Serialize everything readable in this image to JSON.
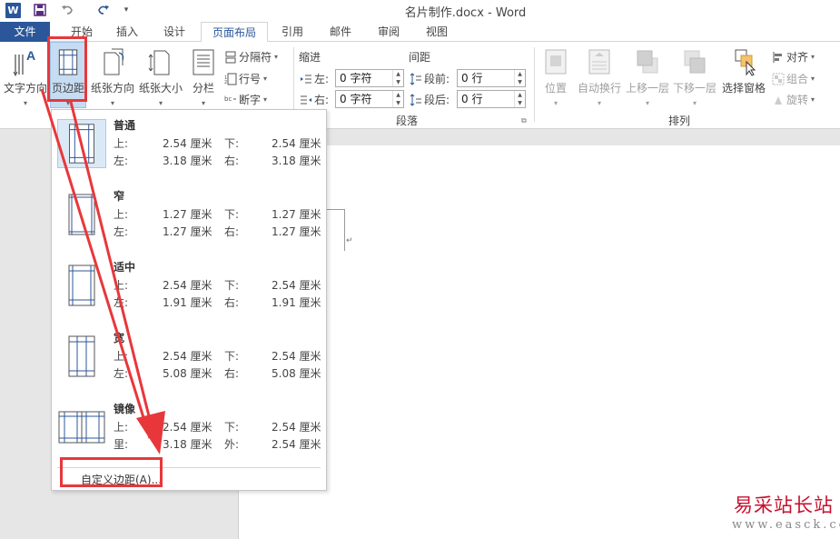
{
  "window": {
    "title": "名片制作.docx - Word"
  },
  "tabs": [
    "文件",
    "开始",
    "插入",
    "设计",
    "页面布局",
    "引用",
    "邮件",
    "审阅",
    "视图"
  ],
  "ribbon": {
    "page_setup": {
      "text_direction": "文字方向",
      "margins": "页边距",
      "orientation": "纸张方向",
      "size": "纸张大小",
      "columns": "分栏",
      "breaks": "分隔符",
      "line_numbers": "行号",
      "hyphenation": "断字"
    },
    "paragraph": {
      "indent_label": "缩进",
      "spacing_label": "间距",
      "left_label": "左:",
      "right_label": "右:",
      "before_label": "段前:",
      "after_label": "段后:",
      "left_value": "0 字符",
      "right_value": "0 字符",
      "before_value": "0 行",
      "after_value": "0 行",
      "group_label": "段落"
    },
    "arrange": {
      "position": "位置",
      "wrap_text": "自动换行",
      "bring_forward": "上移一层",
      "send_backward": "下移一层",
      "selection_pane": "选择窗格",
      "align": "对齐",
      "group": "组合",
      "rotate": "旋转",
      "group_label": "排列"
    }
  },
  "margins_menu": {
    "presets": [
      {
        "name": "普通",
        "top_label": "上:",
        "top": "2.54 厘米",
        "bottom_label": "下:",
        "bottom": "2.54 厘米",
        "left_label": "左:",
        "left": "3.18 厘米",
        "right_label": "右:",
        "right": "3.18 厘米"
      },
      {
        "name": "窄",
        "top_label": "上:",
        "top": "1.27 厘米",
        "bottom_label": "下:",
        "bottom": "1.27 厘米",
        "left_label": "左:",
        "left": "1.27 厘米",
        "right_label": "右:",
        "right": "1.27 厘米"
      },
      {
        "name": "适中",
        "top_label": "上:",
        "top": "2.54 厘米",
        "bottom_label": "下:",
        "bottom": "2.54 厘米",
        "left_label": "左:",
        "left": "1.91 厘米",
        "right_label": "右:",
        "right": "1.91 厘米"
      },
      {
        "name": "宽",
        "top_label": "上:",
        "top": "2.54 厘米",
        "bottom_label": "下:",
        "bottom": "2.54 厘米",
        "left_label": "左:",
        "left": "5.08 厘米",
        "right_label": "右:",
        "right": "5.08 厘米"
      },
      {
        "name": "镜像",
        "top_label": "上:",
        "top": "2.54 厘米",
        "bottom_label": "下:",
        "bottom": "2.54 厘米",
        "left_label": "里:",
        "left": "3.18 厘米",
        "right_label": "外:",
        "right": "2.54 厘米"
      }
    ],
    "custom": "自定义边距(A)..."
  },
  "watermark": {
    "line1": "易采站长站",
    "line2": "www.easck.com"
  },
  "colors": {
    "accent": "#2b579a",
    "highlight_red": "#e8373b"
  }
}
